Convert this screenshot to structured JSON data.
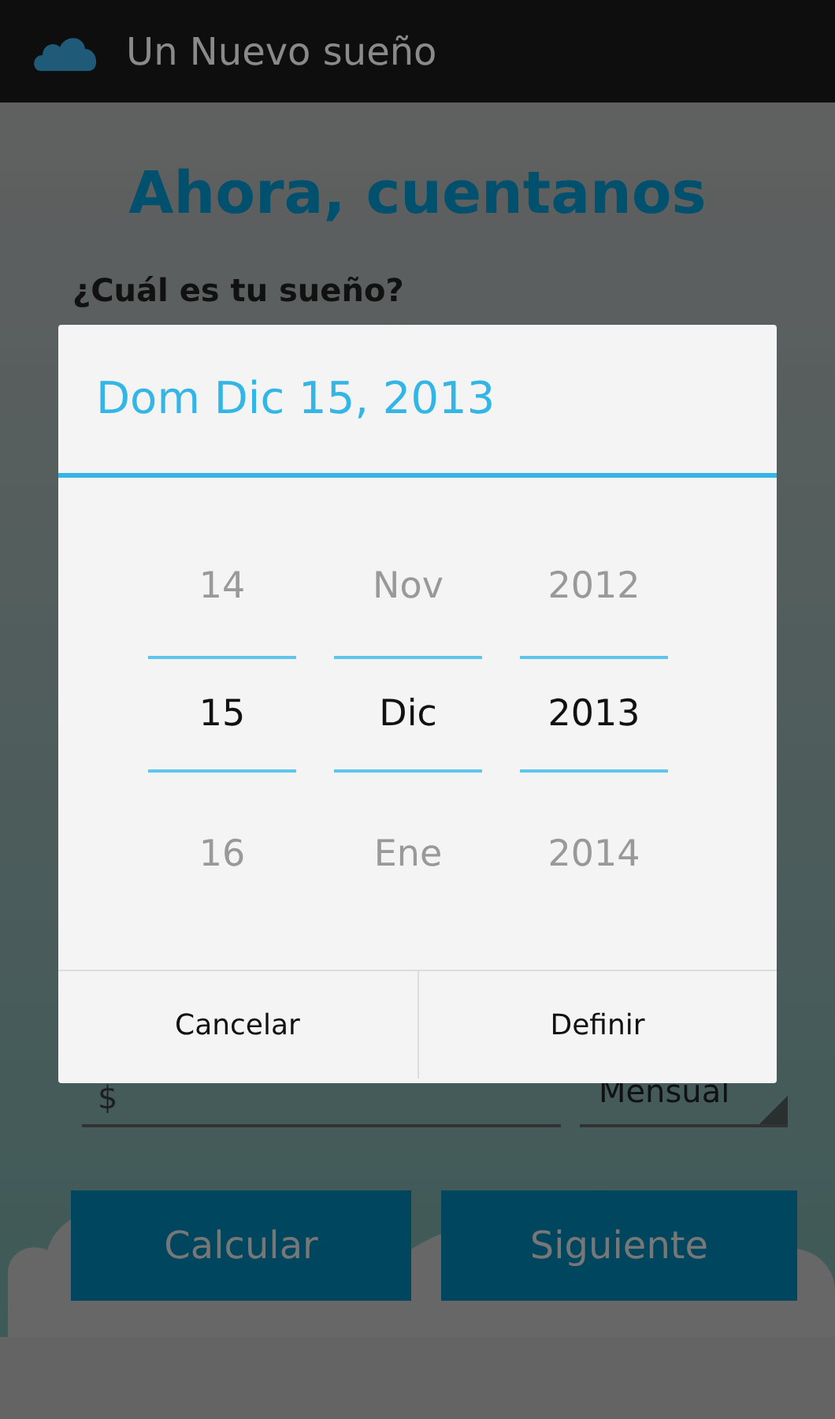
{
  "action_bar": {
    "title": "Un Nuevo sueño"
  },
  "screen": {
    "heading": "Ahora, cuentanos",
    "question": "¿Cuál es tu sueño?",
    "amount_field": {
      "placeholder": "$"
    },
    "frequency": {
      "value": "Mensual"
    },
    "buttons": [
      "Calcular",
      "Siguiente"
    ]
  },
  "dialog": {
    "title": "Dom Dic 15, 2013",
    "columns": [
      {
        "above": "14",
        "current": "15",
        "below": "16"
      },
      {
        "above": "Nov",
        "current": "Dic",
        "below": "Ene"
      },
      {
        "above": "2012",
        "current": "2013",
        "below": "2014"
      }
    ],
    "buttons": [
      "Cancelar",
      "Definir"
    ]
  }
}
